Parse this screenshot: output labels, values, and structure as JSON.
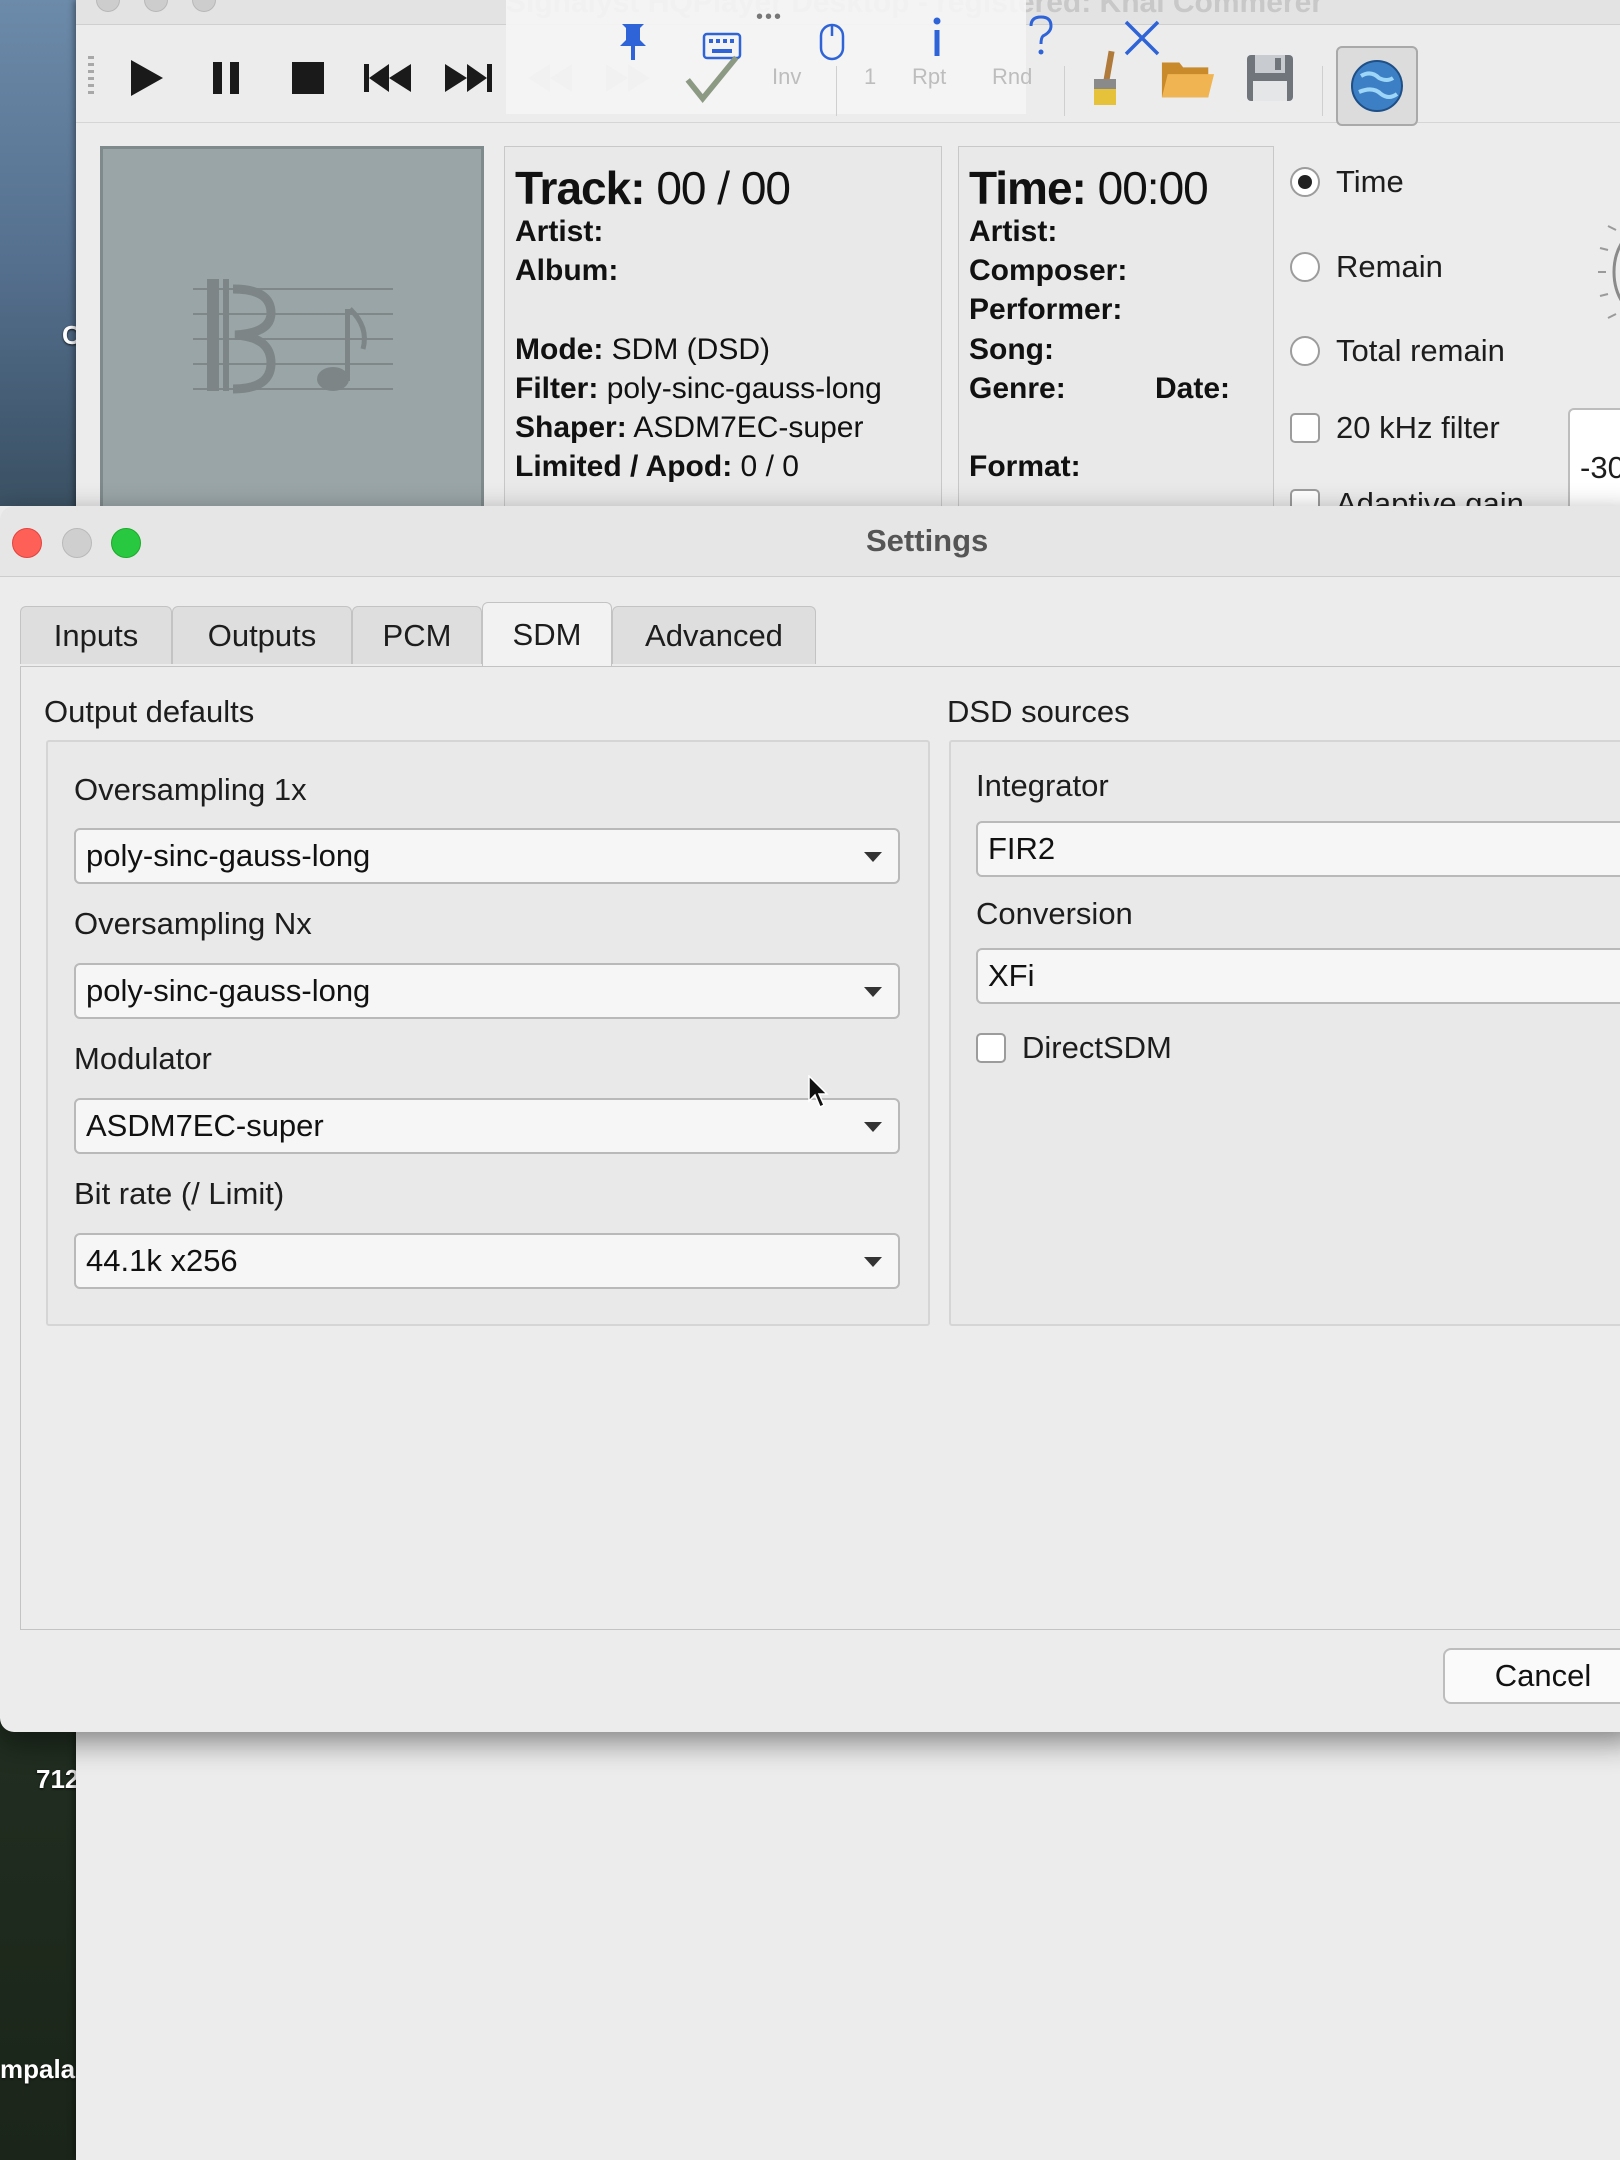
{
  "desktop": {
    "labels": [
      "C",
      "712",
      "mpala"
    ]
  },
  "player": {
    "title": "Signalyst HQPlayer Desktop - registered: Khai Commerer",
    "toolbar": {
      "inv_label": "Inv",
      "one_label": "1",
      "rpt_label": "Rpt",
      "rnd_label": "Rnd",
      "menu_dots": "•••"
    },
    "track": {
      "track_label": "Track:",
      "track_value": "00 / 00",
      "artist_label": "Artist:",
      "album_label": "Album:",
      "mode_label": "Mode:",
      "mode_value": "SDM (DSD)",
      "filter_label": "Filter:",
      "filter_value": "poly-sinc-gauss-long",
      "shaper_label": "Shaper:",
      "shaper_value": "ASDM7EC-super",
      "limited_label": "Limited / Apod:",
      "limited_value": "0 / 0"
    },
    "time": {
      "time_label": "Time:",
      "time_value": "00:00",
      "artist_label": "Artist:",
      "composer_label": "Composer:",
      "performer_label": "Performer:",
      "song_label": "Song:",
      "genre_label": "Genre:",
      "date_label": "Date:",
      "format_label": "Format:"
    },
    "display_options": {
      "time": "Time",
      "remain": "Remain",
      "total_remain": "Total remain",
      "filter_20k": "20 kHz filter",
      "adaptive_gain": "Adaptive gain",
      "volume_value": "-30"
    }
  },
  "settings": {
    "title": "Settings",
    "tabs": [
      {
        "label": "Inputs"
      },
      {
        "label": "Outputs"
      },
      {
        "label": "PCM"
      },
      {
        "label": "SDM"
      },
      {
        "label": "Advanced"
      }
    ],
    "active_tab": "SDM",
    "output_defaults": {
      "title": "Output defaults",
      "oversampling_1x_label": "Oversampling 1x",
      "oversampling_1x_value": "poly-sinc-gauss-long",
      "oversampling_nx_label": "Oversampling Nx",
      "oversampling_nx_value": "poly-sinc-gauss-long",
      "modulator_label": "Modulator",
      "modulator_value": "ASDM7EC-super",
      "bitrate_label": "Bit rate (/ Limit)",
      "bitrate_value": "44.1k x256"
    },
    "dsd_sources": {
      "title": "DSD sources",
      "integrator_label": "Integrator",
      "integrator_value": "FIR2",
      "conversion_label": "Conversion",
      "conversion_value": "XFi",
      "directsdm_label": "DirectSDM",
      "directsdm_checked": false
    },
    "cancel_label": "Cancel"
  },
  "colors": {
    "traffic_red": "#fe5f57",
    "traffic_yellow": "#cfcfcf",
    "traffic_green": "#28c840",
    "accent_blue": "#2e64d8"
  }
}
